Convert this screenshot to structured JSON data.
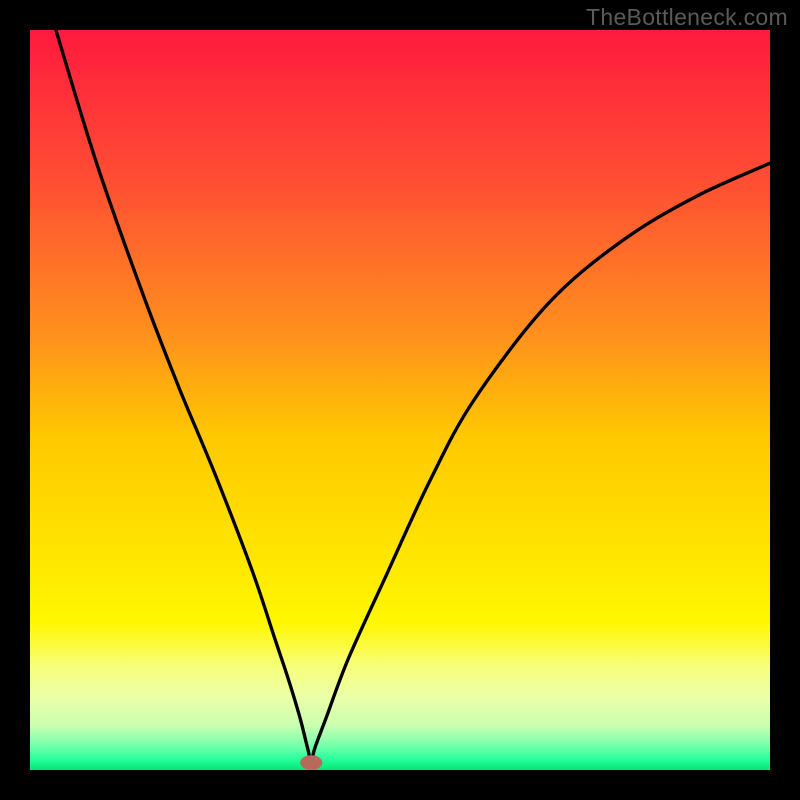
{
  "watermark": "TheBottleneck.com",
  "chart_data": {
    "type": "line",
    "title": "",
    "xlabel": "",
    "ylabel": "",
    "xlim": [
      0,
      100
    ],
    "ylim": [
      0,
      100
    ],
    "gradient_stops": [
      {
        "offset": 0.0,
        "color": "#ff1a3e"
      },
      {
        "offset": 0.2,
        "color": "#ff4d33"
      },
      {
        "offset": 0.4,
        "color": "#ff8c1f"
      },
      {
        "offset": 0.55,
        "color": "#ffc800"
      },
      {
        "offset": 0.7,
        "color": "#ffe400"
      },
      {
        "offset": 0.8,
        "color": "#fff700"
      },
      {
        "offset": 0.86,
        "color": "#f7ff7a"
      },
      {
        "offset": 0.9,
        "color": "#ecffa8"
      },
      {
        "offset": 0.94,
        "color": "#c9ffb0"
      },
      {
        "offset": 0.965,
        "color": "#7dffad"
      },
      {
        "offset": 0.985,
        "color": "#2bff9e"
      },
      {
        "offset": 1.0,
        "color": "#00e676"
      }
    ],
    "series": [
      {
        "name": "bottleneck-curve",
        "x": [
          3.5,
          9,
          15,
          20,
          25,
          30,
          33,
          35,
          36.5,
          37.5,
          38,
          38.5,
          40,
          43,
          48,
          54,
          60,
          70,
          80,
          90,
          100
        ],
        "y": [
          100,
          82,
          65,
          52,
          40,
          27,
          18,
          12,
          7,
          3,
          1.2,
          3,
          7,
          15,
          26,
          39,
          50,
          63,
          71.5,
          77.5,
          82
        ]
      }
    ],
    "marker": {
      "x": 38,
      "y": 1.0,
      "rx": 1.5,
      "ry": 1.0,
      "color": "#b86a5a"
    }
  }
}
